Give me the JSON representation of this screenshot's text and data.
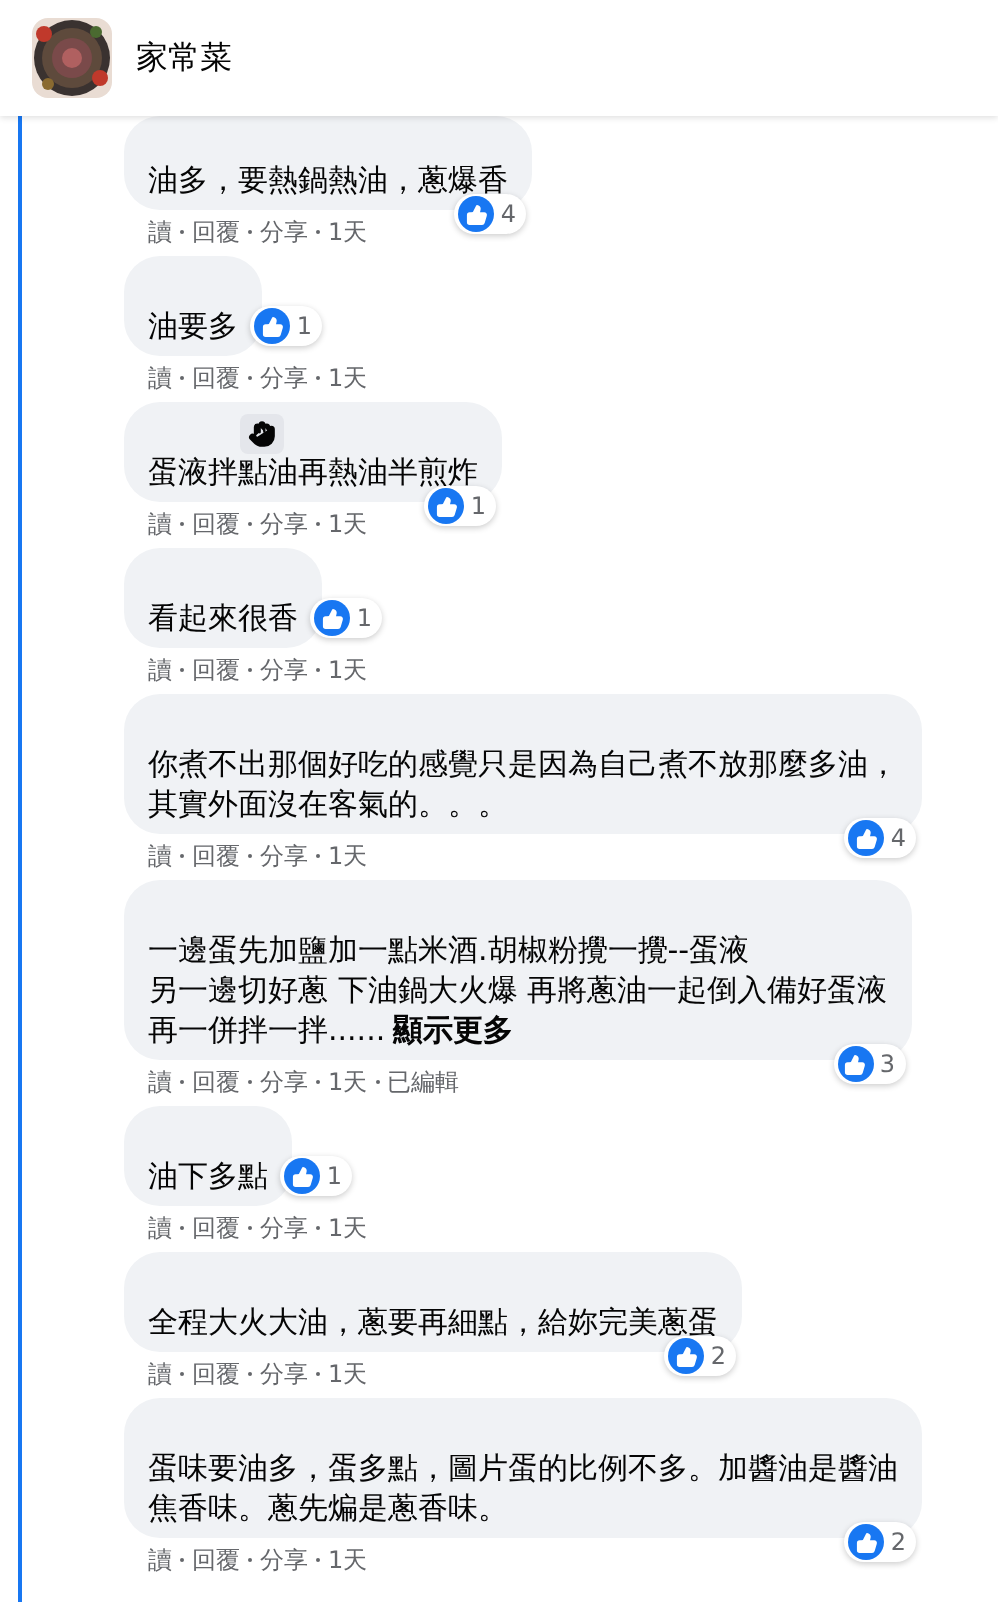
{
  "header": {
    "title": "家常菜"
  },
  "comments": [
    {
      "name_badge": false,
      "lines": [
        "油多，要熱鍋熱油，蔥爆香"
      ],
      "reactions": "4",
      "actions": [
        "讀",
        "回覆",
        "分享"
      ],
      "time": "1天"
    },
    {
      "name_badge": false,
      "lines": [
        "油要多"
      ],
      "reactions": "1",
      "actions": [
        "讀",
        "回覆",
        "分享"
      ],
      "time": "1天"
    },
    {
      "name_badge": true,
      "lines": [
        "蛋液拌點油再熱油半煎炸"
      ],
      "reactions": "1",
      "actions": [
        "讀",
        "回覆",
        "分享"
      ],
      "time": "1天"
    },
    {
      "name_badge": false,
      "lines": [
        "看起來很香"
      ],
      "reactions": "1",
      "actions": [
        "讀",
        "回覆",
        "分享"
      ],
      "time": "1天"
    },
    {
      "name_badge": false,
      "lines": [
        "你煮不出那個好吃的感覺只是因為自己煮不放那麼多油，",
        "其實外面沒在客氣的。。。"
      ],
      "reactions": "4",
      "actions": [
        "讀",
        "回覆",
        "分享"
      ],
      "time": "1天"
    },
    {
      "name_badge": false,
      "lines": [
        "一邊蛋先加鹽加一點米酒.胡椒粉攪一攪--蛋液",
        "另一邊切好蔥 下油鍋大火爆 再將蔥油一起倒入備好蛋液",
        "再一併拌一拌......"
      ],
      "see_more": "顯示更多",
      "reactions": "3",
      "actions": [
        "讀",
        "回覆",
        "分享"
      ],
      "time": "1天",
      "edited": "已編輯"
    },
    {
      "name_badge": false,
      "lines": [
        "油下多點"
      ],
      "reactions": "1",
      "actions": [
        "讀",
        "回覆",
        "分享"
      ],
      "time": "1天"
    },
    {
      "name_badge": false,
      "lines": [
        "全程大火大油，蔥要再細點，給妳完美蔥蛋"
      ],
      "reactions": "2",
      "actions": [
        "讀",
        "回覆",
        "分享"
      ],
      "time": "1天"
    },
    {
      "name_badge": false,
      "lines": [
        "蛋味要油多，蛋多點，圖片蛋的比例不多。加醬油是醬油",
        "焦香味。蔥先煸是蔥香味。"
      ],
      "reactions": "2",
      "actions": [
        "讀",
        "回覆",
        "分享"
      ],
      "time": "1天"
    }
  ]
}
